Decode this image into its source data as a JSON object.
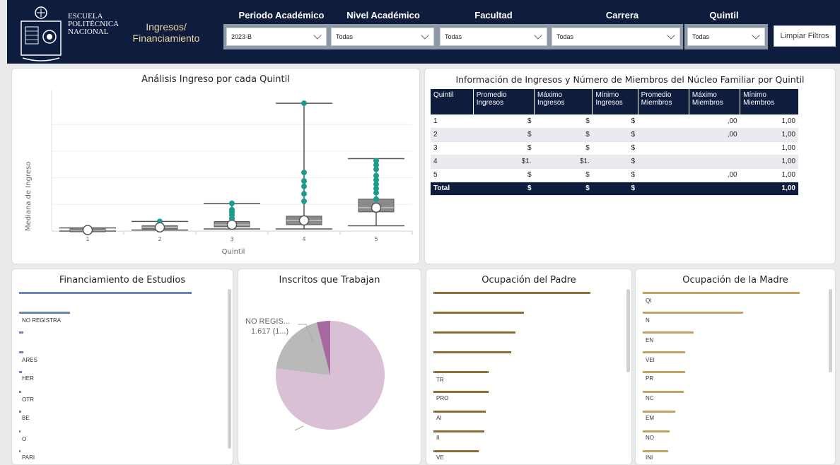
{
  "header": {
    "institution": [
      "ESCUELA",
      "POLITÉCNICA",
      "NACIONAL"
    ],
    "report_title": "Ingresos/ Financiamiento",
    "filters": [
      {
        "label": "Periodo Académico",
        "value": "2023-B"
      },
      {
        "label": "Nivel Académico",
        "value": "Todas"
      },
      {
        "label": "Facultad",
        "value": "Todas"
      },
      {
        "label": "Carrera",
        "value": "Todas"
      },
      {
        "label": "Quintil",
        "value": "Todas"
      }
    ],
    "clear_button": "Limpiar Filtros"
  },
  "boxplot": {
    "title": "Análisis Ingreso por cada Quintil",
    "chart_data": {
      "type": "boxplot",
      "title": "Análisis Ingreso por cada Quintil",
      "xlabel": "Quintil",
      "ylabel": "Mediana de Ingreso",
      "categories": [
        "1",
        "2",
        "3",
        "4",
        "5"
      ],
      "boxes": [
        {
          "category": "1",
          "min": 0.0,
          "q1": 0.005,
          "median": 0.01,
          "q3": 0.02,
          "max": 0.03,
          "outliers": []
        },
        {
          "category": "2",
          "min": 0.01,
          "q1": 0.02,
          "median": 0.035,
          "q3": 0.05,
          "max": 0.09,
          "outliers": [
            0.09
          ]
        },
        {
          "category": "3",
          "min": 0.02,
          "q1": 0.04,
          "median": 0.06,
          "q3": 0.09,
          "max": 0.26,
          "outliers": [
            0.12,
            0.15,
            0.18,
            0.2,
            0.26
          ]
        },
        {
          "category": "4",
          "min": 0.02,
          "q1": 0.06,
          "median": 0.1,
          "q3": 0.14,
          "max": 1.2,
          "outliers": [
            0.28,
            0.35,
            0.42,
            0.47,
            0.55,
            1.2
          ]
        },
        {
          "category": "5",
          "min": 0.05,
          "q1": 0.18,
          "median": 0.22,
          "q3": 0.3,
          "max": 0.68,
          "outliers": [
            0.3,
            0.36,
            0.4,
            0.44,
            0.48,
            0.52,
            0.58,
            0.62,
            0.66
          ]
        }
      ],
      "ylim": [
        0,
        1.3
      ],
      "grid": true
    }
  },
  "table": {
    "title": "Información de Ingresos y Número de Miembros del Núcleo Familiar por Quintil",
    "columns": [
      "Quintil",
      "Promedio Ingresos",
      "Máximo Ingresos",
      "Mínimo Ingresos",
      "Promedio Miembros",
      "Máximo Miembros",
      "Mínimo Miembros"
    ],
    "rows": [
      [
        "1",
        "$",
        "$",
        "$",
        "",
        ",00",
        "1,00"
      ],
      [
        "2",
        "$",
        "$",
        "$",
        "",
        ",00",
        "1,00"
      ],
      [
        "3",
        "$",
        "$",
        "$",
        "",
        "",
        "1,00"
      ],
      [
        "4",
        "$1.",
        "$1.",
        "$",
        "",
        "",
        "1,00"
      ],
      [
        "5",
        "$",
        "$",
        "$",
        "",
        ",00",
        "1,00"
      ]
    ],
    "total": [
      "Total",
      "$",
      "$",
      "$",
      "",
      "",
      "1,00"
    ]
  },
  "financiamiento": {
    "title": "Financiamiento de Estudios",
    "labels": [
      "NO REGISTRA",
      "ARES",
      "HER",
      "OTR",
      "BE",
      "O",
      "PARI"
    ],
    "bar_color": "#6b84b3"
  },
  "trabajan": {
    "title": "Inscritos que Trabajan",
    "label_primary": "NO REGIS...",
    "label_secondary": "1.617 (1...)",
    "chart_data": {
      "type": "pie",
      "slices": [
        {
          "share": 0.77,
          "color": "#d9c0d4"
        },
        {
          "share": 0.19,
          "color": "#b9b9b9"
        },
        {
          "share": 0.04,
          "color": "#a76aa0"
        }
      ]
    }
  },
  "padre": {
    "title": "Ocupación del Padre",
    "labels": [
      "TR",
      "PRO",
      "AI",
      "II",
      "VE"
    ],
    "bar_color": "#8c6d36"
  },
  "madre": {
    "title": "Ocupación de la Madre",
    "labels": [
      "QI",
      "N",
      "EN",
      "VEI",
      "PR",
      "NC",
      "EM",
      "NO",
      "INI"
    ],
    "bar_color": "#c7a25c"
  }
}
